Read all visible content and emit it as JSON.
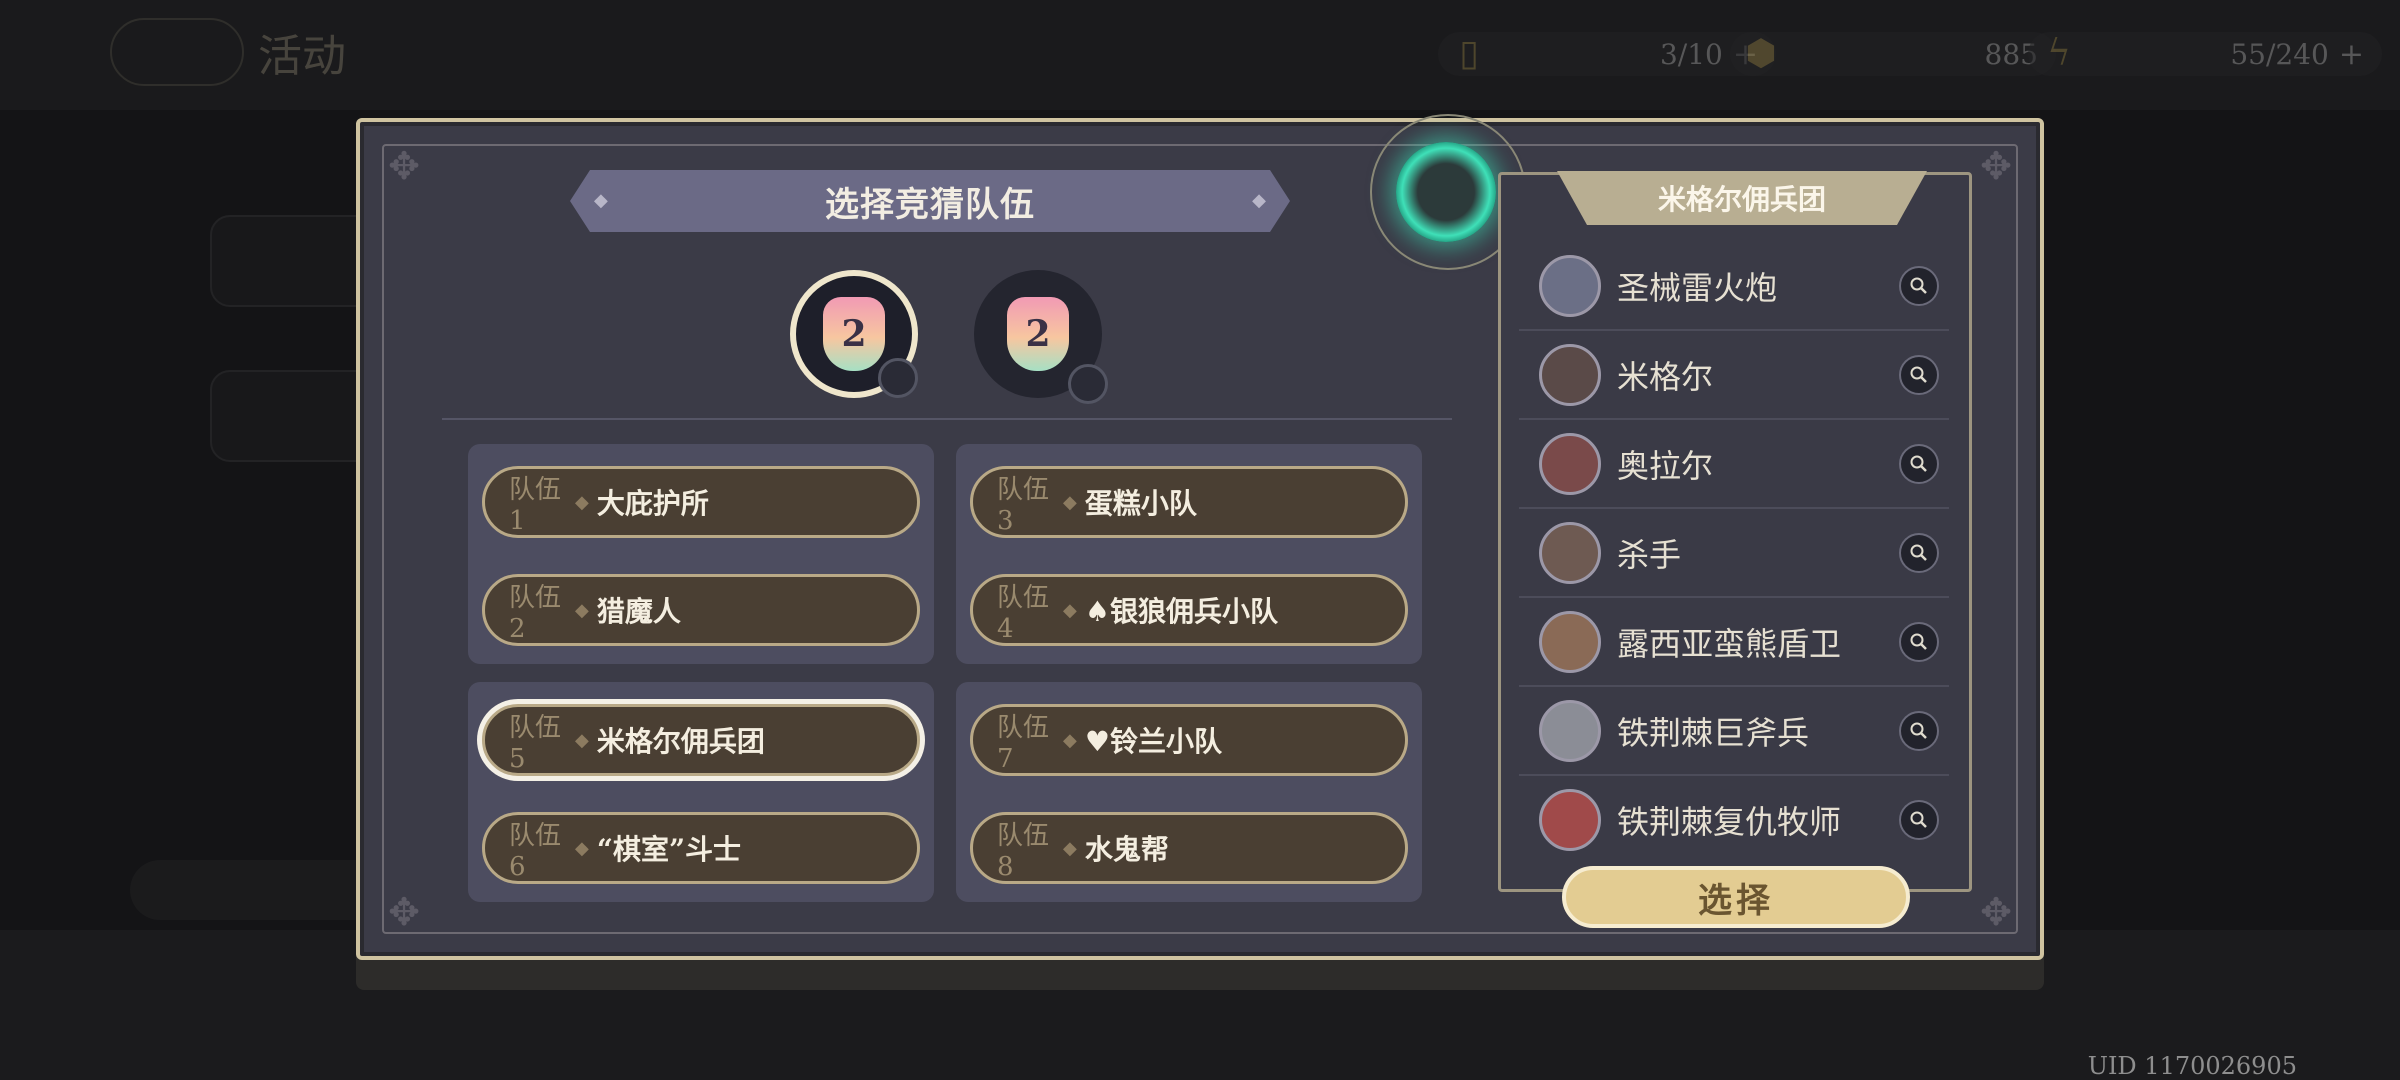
{
  "hud": {
    "title": "活动",
    "resources": [
      {
        "icon": "ticket-icon",
        "value": "3/10"
      },
      {
        "icon": "coin-icon",
        "value": "885"
      },
      {
        "icon": "lightning-icon",
        "value": "55/240"
      }
    ],
    "uid": "UID 1170026905"
  },
  "modal": {
    "title": "选择竞猜队伍",
    "medals": [
      {
        "number": "2",
        "selected": true
      },
      {
        "number": "2",
        "selected": false
      }
    ],
    "teams": [
      {
        "code": "队伍1",
        "name": "大庇护所",
        "selected": false
      },
      {
        "code": "队伍2",
        "name": "猎魔人",
        "selected": false
      },
      {
        "code": "队伍3",
        "name": "蛋糕小队",
        "selected": false
      },
      {
        "code": "队伍4",
        "name": "♠银狼佣兵小队",
        "selected": false
      },
      {
        "code": "队伍5",
        "name": "米格尔佣兵团",
        "selected": true
      },
      {
        "code": "队伍6",
        "name": "“棋室”斗士",
        "selected": false
      },
      {
        "code": "队伍7",
        "name": "♥铃兰小队",
        "selected": false
      },
      {
        "code": "队伍8",
        "name": "水鬼帮",
        "selected": false
      }
    ],
    "roster": {
      "title": "米格尔佣兵团",
      "members": [
        {
          "name": "圣械雷火炮",
          "avatar_color": "#6b6f86"
        },
        {
          "name": "米格尔",
          "avatar_color": "#5a4a48"
        },
        {
          "name": "奥拉尔",
          "avatar_color": "#7a4a4a"
        },
        {
          "name": "杀手",
          "avatar_color": "#6e5a52"
        },
        {
          "name": "露西亚蛮熊盾卫",
          "avatar_color": "#8a6a56"
        },
        {
          "name": "铁荆棘巨斧兵",
          "avatar_color": "#8b8d96"
        },
        {
          "name": "铁荆棘复仇牧师",
          "avatar_color": "#a04a4a"
        }
      ]
    },
    "choose_label": "选择"
  }
}
